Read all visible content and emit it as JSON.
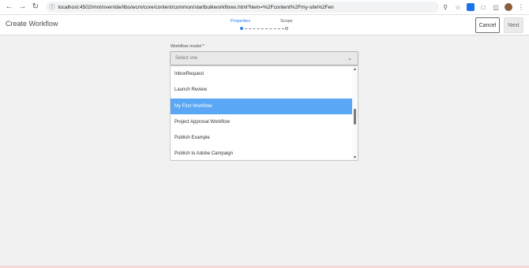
{
  "browser": {
    "url": "localhost:4502/mnt/override/libs/wcm/core/content/common/startbulkworkflows.html?item=%2Fcontent%2Fmy-site%2Fen",
    "nav": [
      "back-icon",
      "forward-icon",
      "reload-icon"
    ],
    "icons": [
      "zoom-icon",
      "star-icon",
      "extension-icon",
      "puzzle-icon",
      "sidebar-icon",
      "profile-avatar",
      "menu-icon"
    ],
    "colors": {
      "extension": "#1a73e8"
    }
  },
  "header": {
    "title": "Create Workflow",
    "steps": [
      {
        "label": "Properties",
        "active": true
      },
      {
        "label": "Scope",
        "active": false
      }
    ],
    "cancel_label": "Cancel",
    "next_label": "Next",
    "accent": "#2680eb"
  },
  "form": {
    "model_label": "Workflow model *",
    "model_placeholder": "Select one",
    "options": [
      {
        "label": "InboxRequest",
        "selected": false
      },
      {
        "label": "Launch Review",
        "selected": false
      },
      {
        "label": "My First Workflow",
        "selected": true
      },
      {
        "label": "Project Approval Workflow",
        "selected": false
      },
      {
        "label": "Publish Example",
        "selected": false
      },
      {
        "label": "Publish to Adobe Campaign",
        "selected": false
      }
    ],
    "selected_color": "#5aa7f5"
  }
}
